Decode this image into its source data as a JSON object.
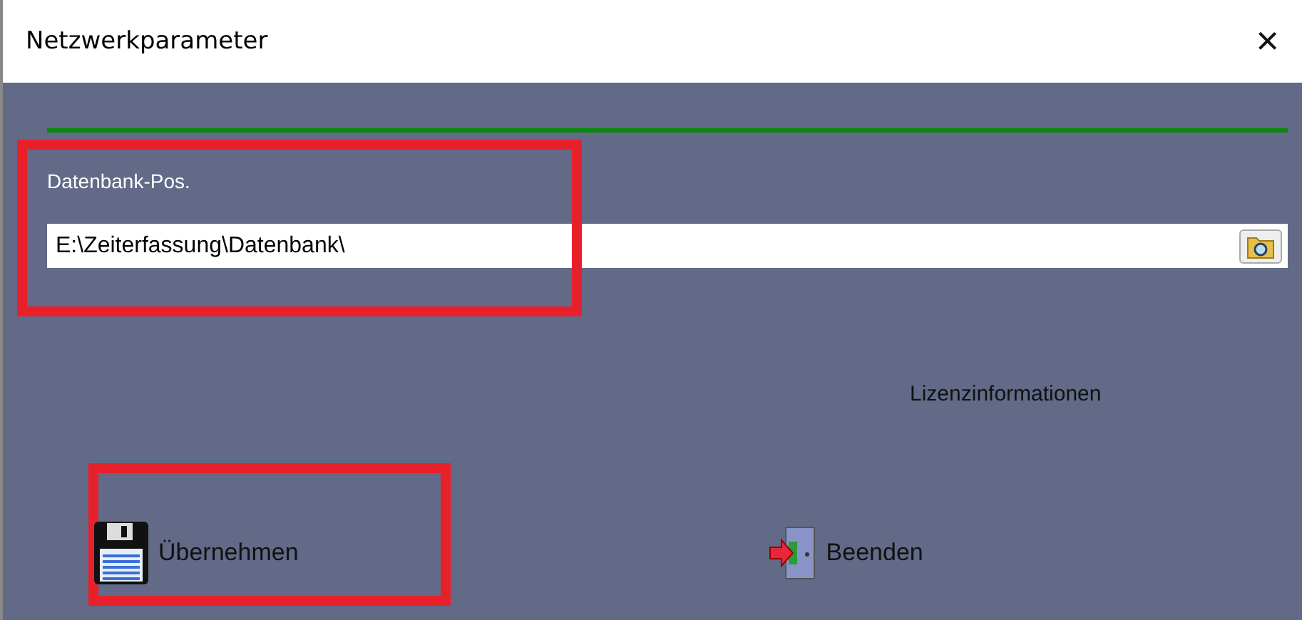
{
  "window": {
    "title": "Netzwerkparameter",
    "close": "×"
  },
  "database": {
    "label": "Datenbank-Pos.",
    "value": "E:\\Zeiterfassung\\Datenbank\\"
  },
  "license_link": "Lizenzinformationen",
  "buttons": [
    {
      "kind": "save",
      "label": "Übernehmen"
    },
    {
      "kind": "exit",
      "label": "Beenden"
    }
  ]
}
